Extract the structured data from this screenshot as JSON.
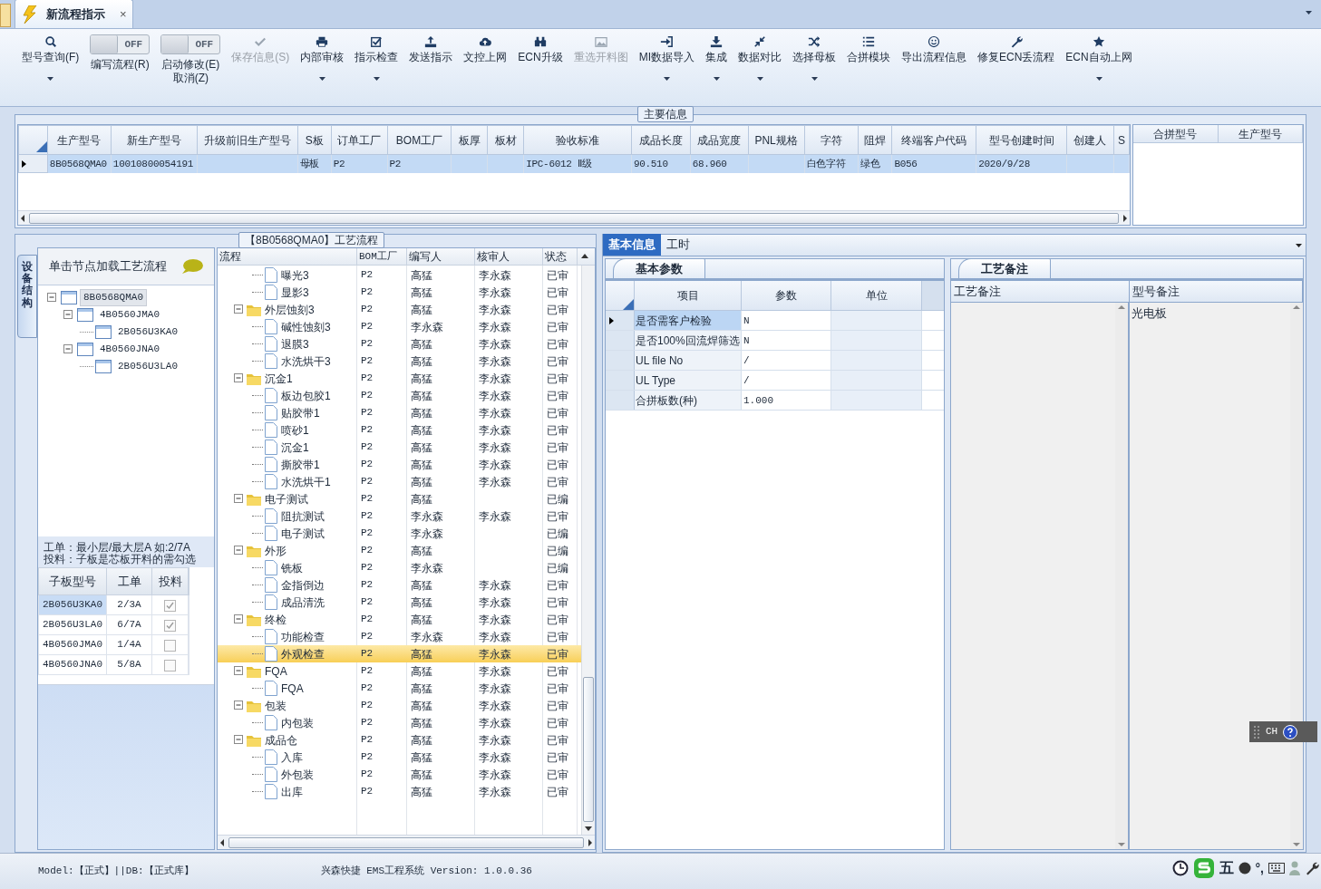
{
  "document_tab": {
    "title": "新流程指示",
    "close": "×",
    "selected": true
  },
  "toolbar": [
    {
      "kind": "button",
      "label": "型号查询(F)",
      "disabled": false,
      "dropdown": true
    },
    {
      "kind": "toggle",
      "label": "编写流程(R)",
      "toggle_text": "OFF",
      "on": false
    },
    {
      "kind": "toggle",
      "label": "启动修改(E)",
      "second_line": "取消(Z)",
      "toggle_text": "OFF",
      "on": false
    },
    {
      "kind": "button",
      "label": "保存信息(S)",
      "disabled": true,
      "dropdown": false
    },
    {
      "kind": "button",
      "label": "内部审核",
      "disabled": false,
      "dropdown": true
    },
    {
      "kind": "button",
      "label": "指示检查",
      "disabled": false,
      "dropdown": true
    },
    {
      "kind": "button",
      "label": "发送指示",
      "disabled": false,
      "dropdown": false
    },
    {
      "kind": "button",
      "label": "文控上网",
      "disabled": false,
      "dropdown": false
    },
    {
      "kind": "button",
      "label": "ECN升级",
      "disabled": false,
      "dropdown": false
    },
    {
      "kind": "button",
      "label": "重选开料图",
      "disabled": true,
      "dropdown": false
    },
    {
      "kind": "button",
      "label": "MI数据导入",
      "disabled": false,
      "dropdown": true
    },
    {
      "kind": "button",
      "label": "集成",
      "disabled": false,
      "dropdown": true
    },
    {
      "kind": "button",
      "label": "数据对比",
      "disabled": false,
      "dropdown": true
    },
    {
      "kind": "button",
      "label": "选择母板",
      "disabled": false,
      "dropdown": true
    },
    {
      "kind": "button",
      "label": "合拼模块",
      "disabled": false,
      "dropdown": false
    },
    {
      "kind": "button",
      "label": "导出流程信息",
      "disabled": false,
      "dropdown": false
    },
    {
      "kind": "button",
      "label": "修复ECN丢流程",
      "disabled": false,
      "dropdown": false
    },
    {
      "kind": "button",
      "label": "ECN自动上网",
      "disabled": false,
      "dropdown": true
    }
  ],
  "main_info": {
    "title": "主要信息",
    "columns": [
      "生产型号",
      "新生产型号",
      "升级前旧生产型号",
      "S板",
      "订单工厂",
      "BOM工厂",
      "板厚",
      "板材",
      "验收标准",
      "成品长度",
      "成品宽度",
      "PNL规格",
      "字符",
      "阻焊",
      "终端客户代码",
      "型号创建时间",
      "创建人",
      "S"
    ],
    "rows": [
      {
        "selected": true,
        "cells": [
          "8B0568QMA0",
          "10010800054191",
          null,
          "母板",
          "P2",
          "P2",
          null,
          null,
          "IPC-6012 Ⅱ级",
          "90.510",
          "68.960",
          null,
          "白色字符",
          "绿色",
          "B056",
          "2020/9/28",
          null,
          null
        ]
      }
    ],
    "side_columns": [
      "合拼型号",
      "生产型号"
    ]
  },
  "structure_panel": {
    "side_tab": "设备结构",
    "hint": "单击节点加载工艺流程",
    "tree": [
      {
        "label": "8B0568QMA0",
        "selected": true,
        "children": [
          {
            "label": "4B0560JMA0",
            "selected": false,
            "children": [
              {
                "label": "2B056U3KA0",
                "selected": false
              }
            ]
          },
          {
            "label": "4B0560JNA0",
            "selected": false,
            "children": [
              {
                "label": "2B056U3LA0",
                "selected": false
              }
            ]
          }
        ]
      }
    ],
    "notes": [
      "工单：最小层/最大层A 如:2/7A",
      "投料：子板是芯板开料的需勾选"
    ],
    "table": {
      "columns": [
        "子板型号",
        "工单",
        "投料"
      ],
      "rows": [
        {
          "model": "2B056U3KA0",
          "order": "2/3A",
          "checked": true,
          "selected": true
        },
        {
          "model": "2B056U3LA0",
          "order": "6/7A",
          "checked": true,
          "selected": false
        },
        {
          "model": "4B0560JMA0",
          "order": "1/4A",
          "checked": false,
          "selected": false
        },
        {
          "model": "4B0560JNA0",
          "order": "5/8A",
          "checked": false,
          "selected": false
        }
      ]
    }
  },
  "process_flow": {
    "title": "【8B0568QMA0】工艺流程",
    "columns": [
      "流程",
      "BOM工厂",
      "编写人",
      "核审人",
      "状态"
    ],
    "rows": [
      {
        "kind": "file",
        "label": "曝光3",
        "bom": "P2",
        "writer": "高猛",
        "reviewer": "李永森",
        "status": "已审",
        "selected": false
      },
      {
        "kind": "file",
        "label": "显影3",
        "bom": "P2",
        "writer": "高猛",
        "reviewer": "李永森",
        "status": "已审",
        "selected": false
      },
      {
        "kind": "folder",
        "label": "外层蚀刻3",
        "bom": "P2",
        "writer": "高猛",
        "reviewer": "李永森",
        "status": "已审",
        "selected": false,
        "expanded": true,
        "children": [
          {
            "kind": "file",
            "label": "碱性蚀刻3",
            "bom": "P2",
            "writer": "李永森",
            "reviewer": "李永森",
            "status": "已审",
            "selected": false
          },
          {
            "kind": "file",
            "label": "退膜3",
            "bom": "P2",
            "writer": "高猛",
            "reviewer": "李永森",
            "status": "已审",
            "selected": false
          },
          {
            "kind": "file",
            "label": "水洗烘干3",
            "bom": "P2",
            "writer": "高猛",
            "reviewer": "李永森",
            "status": "已审",
            "selected": false
          }
        ]
      },
      {
        "kind": "folder",
        "label": "沉金1",
        "bom": "P2",
        "writer": "高猛",
        "reviewer": "李永森",
        "status": "已审",
        "selected": false,
        "expanded": true,
        "children": [
          {
            "kind": "file",
            "label": "板边包胶1",
            "bom": "P2",
            "writer": "高猛",
            "reviewer": "李永森",
            "status": "已审",
            "selected": false
          },
          {
            "kind": "file",
            "label": "贴胶带1",
            "bom": "P2",
            "writer": "高猛",
            "reviewer": "李永森",
            "status": "已审",
            "selected": false
          },
          {
            "kind": "file",
            "label": "喷砂1",
            "bom": "P2",
            "writer": "高猛",
            "reviewer": "李永森",
            "status": "已审",
            "selected": false
          },
          {
            "kind": "file",
            "label": "沉金1",
            "bom": "P2",
            "writer": "高猛",
            "reviewer": "李永森",
            "status": "已审",
            "selected": false
          },
          {
            "kind": "file",
            "label": "撕胶带1",
            "bom": "P2",
            "writer": "高猛",
            "reviewer": "李永森",
            "status": "已审",
            "selected": false
          },
          {
            "kind": "file",
            "label": "水洗烘干1",
            "bom": "P2",
            "writer": "高猛",
            "reviewer": "李永森",
            "status": "已审",
            "selected": false
          }
        ]
      },
      {
        "kind": "folder",
        "label": "电子测试",
        "bom": "P2",
        "writer": "高猛",
        "status": "已编",
        "selected": false,
        "expanded": true,
        "children": [
          {
            "kind": "file",
            "label": "阻抗测试",
            "bom": "P2",
            "writer": "李永森",
            "reviewer": "李永森",
            "status": "已审",
            "selected": false
          },
          {
            "kind": "file",
            "label": "电子测试",
            "bom": "P2",
            "writer": "李永森",
            "status": "已编",
            "selected": false
          }
        ]
      },
      {
        "kind": "folder",
        "label": "外形",
        "bom": "P2",
        "writer": "高猛",
        "status": "已编",
        "selected": false,
        "expanded": true,
        "children": [
          {
            "kind": "file",
            "label": "铣板",
            "bom": "P2",
            "writer": "李永森",
            "status": "已编",
            "selected": false
          },
          {
            "kind": "file",
            "label": "金指倒边",
            "bom": "P2",
            "writer": "高猛",
            "reviewer": "李永森",
            "status": "已审",
            "selected": false
          },
          {
            "kind": "file",
            "label": "成品清洗",
            "bom": "P2",
            "writer": "高猛",
            "reviewer": "李永森",
            "status": "已审",
            "selected": false
          }
        ]
      },
      {
        "kind": "folder",
        "label": "终检",
        "bom": "P2",
        "writer": "高猛",
        "reviewer": "李永森",
        "status": "已审",
        "selected": false,
        "expanded": true,
        "children": [
          {
            "kind": "file",
            "label": "功能检查",
            "bom": "P2",
            "writer": "李永森",
            "reviewer": "李永森",
            "status": "已审",
            "selected": false
          },
          {
            "kind": "file",
            "label": "外观检查",
            "bom": "P2",
            "writer": "高猛",
            "reviewer": "李永森",
            "status": "已审",
            "selected": true
          }
        ]
      },
      {
        "kind": "folder",
        "label": "FQA",
        "bom": "P2",
        "writer": "高猛",
        "reviewer": "李永森",
        "status": "已审",
        "selected": false,
        "expanded": true,
        "children": [
          {
            "kind": "file",
            "label": "FQA",
            "bom": "P2",
            "writer": "高猛",
            "reviewer": "李永森",
            "status": "已审",
            "selected": false
          }
        ]
      },
      {
        "kind": "folder",
        "label": "包装",
        "bom": "P2",
        "writer": "高猛",
        "reviewer": "李永森",
        "status": "已审",
        "selected": false,
        "expanded": true,
        "children": [
          {
            "kind": "file",
            "label": "内包装",
            "bom": "P2",
            "writer": "高猛",
            "reviewer": "李永森",
            "status": "已审",
            "selected": false
          }
        ]
      },
      {
        "kind": "folder",
        "label": "成品仓",
        "bom": "P2",
        "writer": "高猛",
        "reviewer": "李永森",
        "status": "已审",
        "selected": false,
        "expanded": true,
        "children": [
          {
            "kind": "file",
            "label": "入库",
            "bom": "P2",
            "writer": "高猛",
            "reviewer": "李永森",
            "status": "已审",
            "selected": false
          },
          {
            "kind": "file",
            "label": "外包装",
            "bom": "P2",
            "writer": "高猛",
            "reviewer": "李永森",
            "status": "已审",
            "selected": false
          },
          {
            "kind": "file",
            "label": "出库",
            "bom": "P2",
            "writer": "高猛",
            "reviewer": "李永森",
            "status": "已审",
            "selected": false
          }
        ]
      }
    ]
  },
  "detail_tabs": [
    {
      "label": "基本信息",
      "selected": true
    },
    {
      "label": "工时",
      "selected": false
    }
  ],
  "basic_params": {
    "tab": "基本参数",
    "columns": [
      "项目",
      "参数",
      "单位"
    ],
    "rows": [
      {
        "item": "是否需客户检验",
        "value": "N",
        "selected": true
      },
      {
        "item": "是否100%回流焊筛选",
        "value": "N",
        "selected": false
      },
      {
        "item": "UL file No",
        "value": "/",
        "selected": false
      },
      {
        "item": "UL Type",
        "value": "/",
        "selected": false
      },
      {
        "item": "合拼板数(种)",
        "value": "1.000",
        "selected": false
      }
    ]
  },
  "remarks": {
    "tab": "工艺备注",
    "columns": [
      "工艺备注",
      "型号备注"
    ],
    "model_remark": "光电板"
  },
  "status_bar": {
    "left": "Model:【正式】||DB:【正式库】",
    "center": "兴森快捷 EMS工程系统 Version: 1.0.0.36"
  },
  "ime_bar": {
    "language": "CH"
  },
  "tray": {
    "input_mode": "五",
    "punctuation": "°,"
  }
}
